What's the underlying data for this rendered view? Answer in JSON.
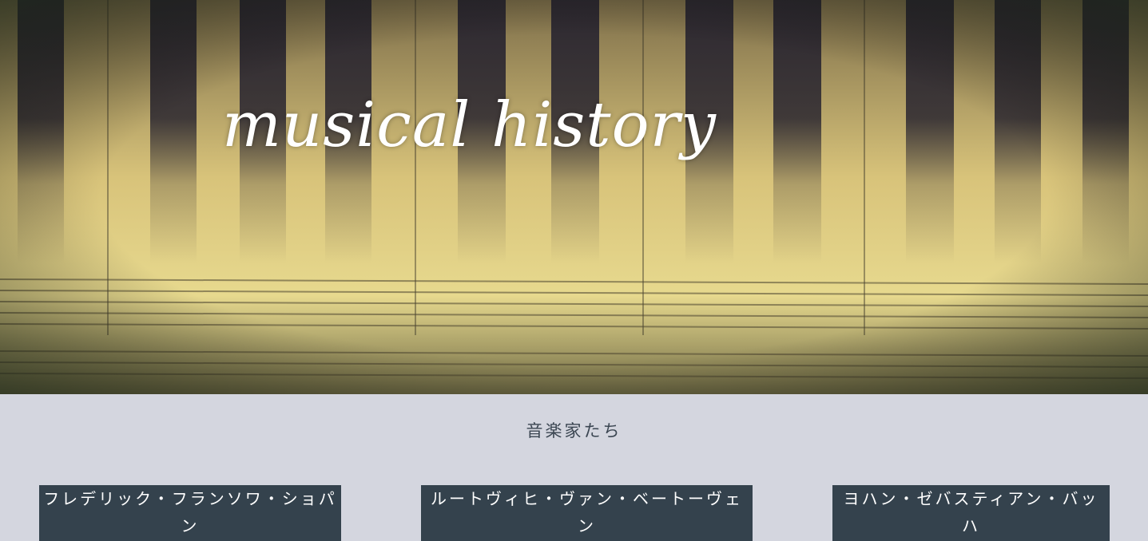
{
  "header": {
    "title": "musical history",
    "image_icon": "piano-keys-grunge-image"
  },
  "composers_section": {
    "heading": "音楽家たち",
    "cards": [
      {
        "name": "フレデリック・フランソワ・ショパン"
      },
      {
        "name": "ルートヴィヒ・ヴァン・ベートーヴェン"
      },
      {
        "name": "ヨハン・ゼバスティアン・バッハ"
      }
    ]
  },
  "colors": {
    "section_background": "#d4d6df",
    "card_background": "#34424d",
    "heading_text": "#3b4652",
    "title_text": "#ffffff"
  }
}
